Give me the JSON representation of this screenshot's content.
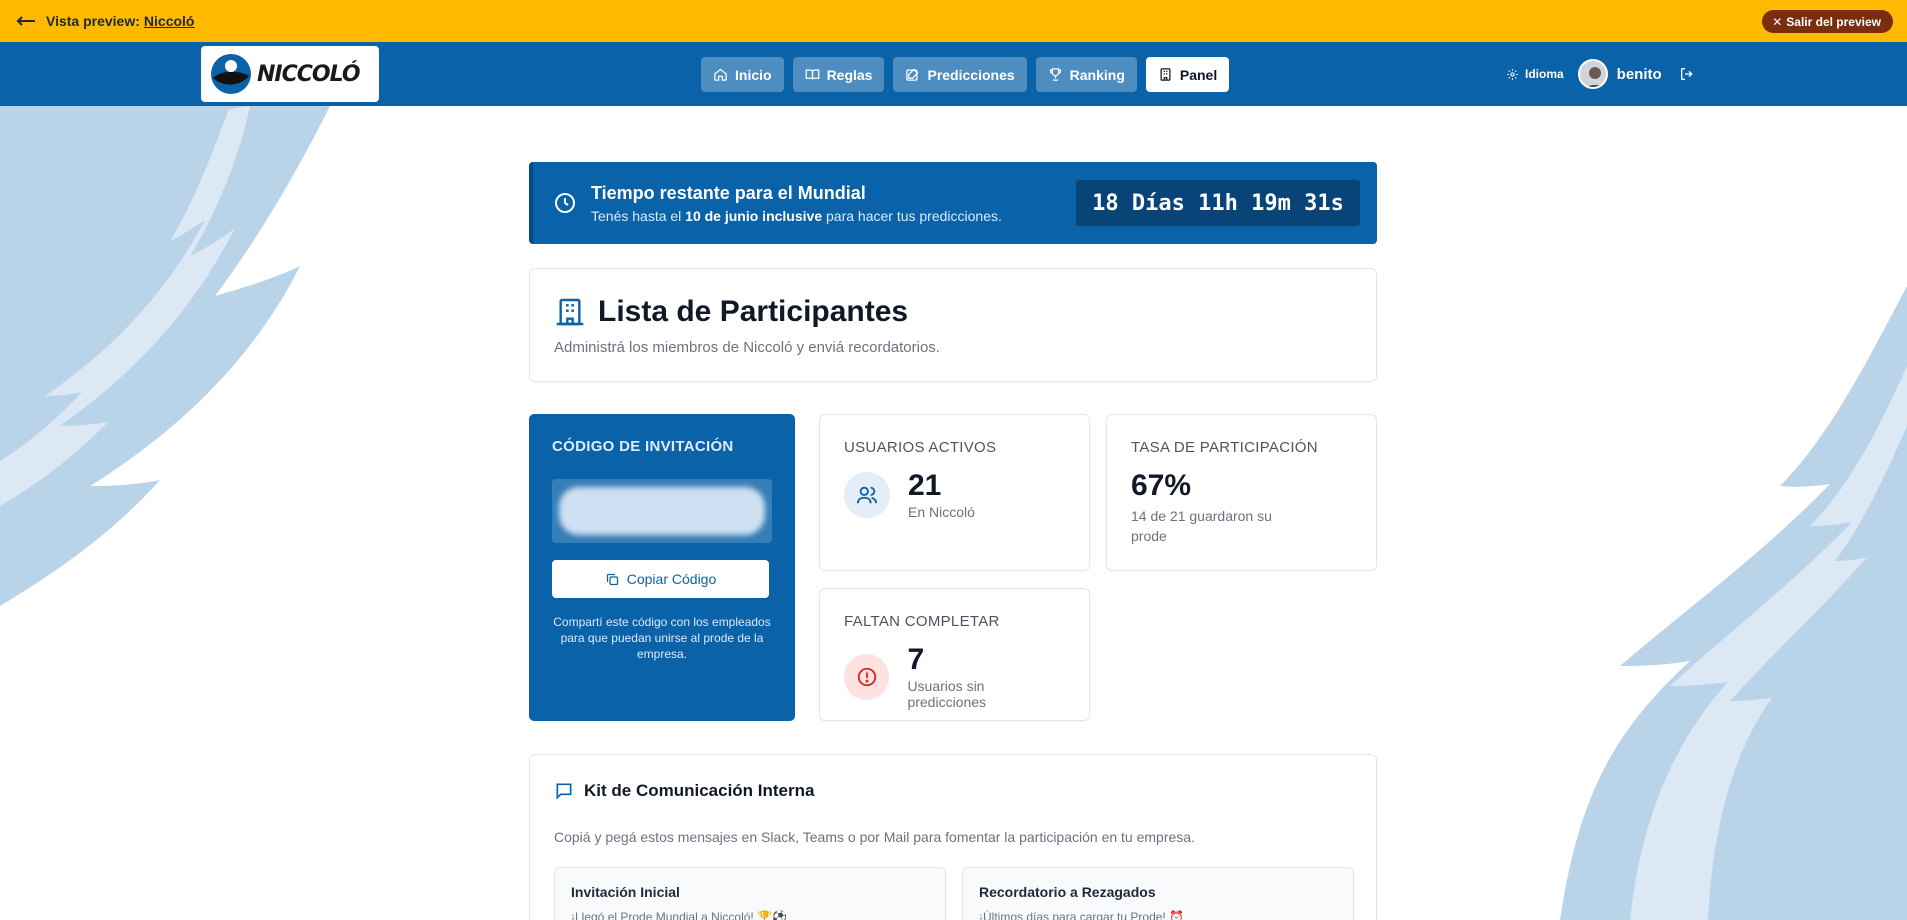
{
  "preview": {
    "label": "Vista preview:",
    "company_link": "Niccoló",
    "exit_label": "Salir del preview"
  },
  "header": {
    "logo_text": "NICCOLÓ",
    "nav": [
      {
        "label": "Inicio",
        "icon": "home-icon"
      },
      {
        "label": "Reglas",
        "icon": "book-icon"
      },
      {
        "label": "Predicciones",
        "icon": "edit-icon"
      },
      {
        "label": "Ranking",
        "icon": "trophy-icon"
      },
      {
        "label": "Panel",
        "icon": "building-icon",
        "active": true
      }
    ],
    "language_label": "Idioma",
    "username": "benito"
  },
  "countdown": {
    "title": "Tiempo restante para el Mundial",
    "sub_prefix": "Tenés hasta el ",
    "sub_bold": "10 de junio inclusive",
    "sub_suffix": " para hacer tus predicciones.",
    "timer": "18 Días 11h 19m 31s"
  },
  "page": {
    "title": "Lista de Participantes",
    "subtitle": "Administrá los miembros de Niccoló y enviá recordatorios."
  },
  "invite": {
    "label": "CÓDIGO DE INVITACIÓN",
    "copy_label": "Copiar Código",
    "help": "Compartí este código con los empleados para que puedan unirse al prode de la empresa."
  },
  "stats": {
    "active": {
      "label": "USUARIOS ACTIVOS",
      "value": "21",
      "sub": "En Niccoló"
    },
    "rate": {
      "label": "TASA DE PARTICIPACIÓN",
      "value": "67%",
      "sub": "14 de 21 guardaron su prode"
    },
    "missing": {
      "label": "FALTAN COMPLETAR",
      "value": "7",
      "sub": "Usuarios sin predicciones"
    }
  },
  "kit": {
    "title": "Kit de Comunicación Interna",
    "subtitle": "Copiá y pegá estos mensajes en Slack, Teams o por Mail para fomentar la participación en tu empresa.",
    "messages": [
      {
        "title": "Invitación Inicial",
        "preview": "¡Llegó el Prode Mundial a Niccoló! 🏆⚽"
      },
      {
        "title": "Recordatorio a Rezagados",
        "preview": "¡Últimos días para cargar tu Prode! ⏰"
      }
    ]
  },
  "colors": {
    "brand_blue": "#0a62a8",
    "preview_yellow": "#ffb900",
    "exit_brown": "#7a2e0e"
  }
}
